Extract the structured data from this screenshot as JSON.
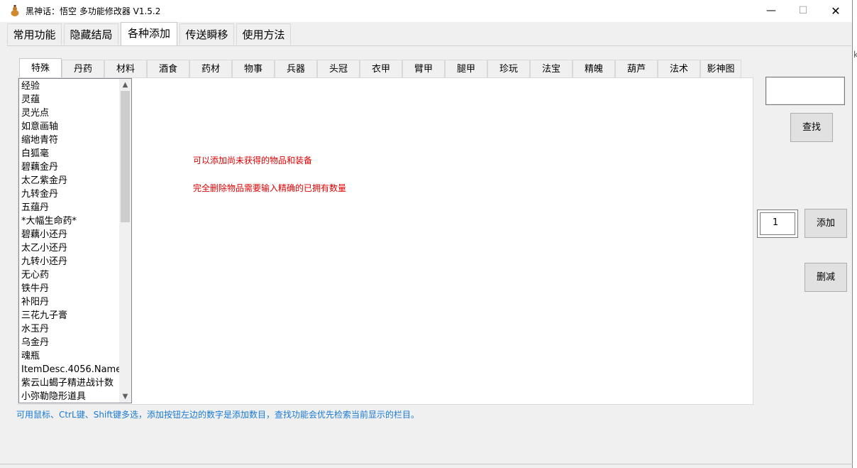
{
  "window": {
    "title": "黑神话：悟空 多功能修改器  V1.5.2",
    "minimize_glyph": "—",
    "maximize_glyph": "☐",
    "close_glyph": "✕",
    "icon": "gourd-icon"
  },
  "main_tabs": [
    {
      "label": "常用功能"
    },
    {
      "label": "隐藏结局"
    },
    {
      "label": "各种添加"
    },
    {
      "label": "传送瞬移"
    },
    {
      "label": "使用方法"
    }
  ],
  "sub_tabs": [
    {
      "label": "特殊"
    },
    {
      "label": "丹药"
    },
    {
      "label": "材料"
    },
    {
      "label": "酒食"
    },
    {
      "label": "药材"
    },
    {
      "label": "物事"
    },
    {
      "label": "兵器"
    },
    {
      "label": "头冠"
    },
    {
      "label": "衣甲"
    },
    {
      "label": "臂甲"
    },
    {
      "label": "腿甲"
    },
    {
      "label": "珍玩"
    },
    {
      "label": "法宝"
    },
    {
      "label": "精魄"
    },
    {
      "label": "葫芦"
    },
    {
      "label": "法术"
    },
    {
      "label": "影神图"
    }
  ],
  "item_list": [
    "经验",
    "灵蕴",
    "灵光点",
    "如意画轴",
    "缩地青符",
    "白狐毫",
    "碧藕金丹",
    "太乙紫金丹",
    "九转金丹",
    "五蕴丹",
    "*大幅生命药*",
    "碧藕小还丹",
    "太乙小还丹",
    "九转小还丹",
    "无心药",
    "铁牛丹",
    "补阳丹",
    "三花九子膏",
    "水玉丹",
    "乌金丹",
    "魂瓶",
    "ItemDesc.4056.Name",
    "紫云山蝎子精进战计数",
    "小弥勒隐形道具"
  ],
  "scroll": {
    "up_glyph": "▲",
    "down_glyph": "▼"
  },
  "hints": {
    "line1": "可以添加尚未获得的物品和装备",
    "line2": "完全删除物品需要输入精确的已拥有数量",
    "footer": "可用鼠标、CtrL键、Shift键多选，添加按钮左边的数字是添加数目，查找功能会优先检索当前显示的栏目。"
  },
  "search": {
    "value": "",
    "button_label": "查找"
  },
  "quantity": {
    "value": "1"
  },
  "buttons": {
    "add_label": "添加",
    "delete_label": "删减"
  },
  "side_fragment": "k"
}
